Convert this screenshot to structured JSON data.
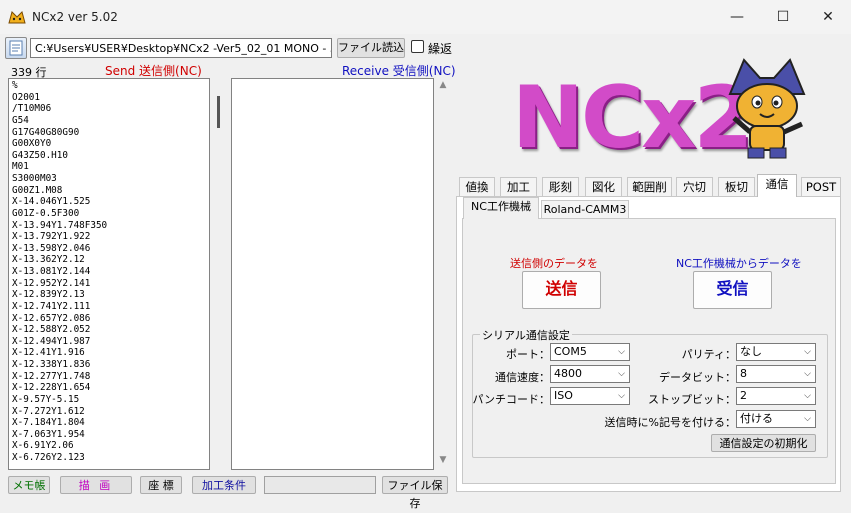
{
  "window": {
    "title": "NCx2 ver 5.02",
    "minimize": "—",
    "maximize": "☐",
    "close": "✕"
  },
  "toolbar": {
    "file_path": "C:¥Users¥USER¥Desktop¥NCx2 -Ver5_02_01 MONO - 5¥",
    "load_button": "ファイル読込",
    "repeat_label": "繰返"
  },
  "line_count": "339 行",
  "send_label": "Send 送信側(NC)",
  "recv_label": "Receive 受信側(NC)",
  "send_lines": [
    "%",
    "O2001",
    "/T10M06",
    "G54",
    "G17G40G80G90",
    "G00X0Y0",
    "G43Z50.H10",
    "M01",
    "S3000M03",
    "G00Z1.M08",
    "X-14.046Y1.525",
    "G01Z-0.5F300",
    "X-13.94Y1.748F350",
    "X-13.792Y1.922",
    "X-13.598Y2.046",
    "X-13.362Y2.12",
    "X-13.081Y2.144",
    "X-12.952Y2.141",
    "X-12.839Y2.13",
    "X-12.741Y2.111",
    "X-12.657Y2.086",
    "X-12.588Y2.052",
    "X-12.494Y1.987",
    "X-12.41Y1.916",
    "X-12.338Y1.836",
    "X-12.277Y1.748",
    "X-12.228Y1.654",
    "X-9.57Y-5.15",
    "X-7.272Y1.612",
    "X-7.184Y1.804",
    "X-7.063Y1.954",
    "X-6.91Y2.06",
    "X-6.726Y2.123"
  ],
  "bottom_buttons": {
    "memo": "メモ帳",
    "draw": "描 画",
    "coord": "座 標",
    "cond": "加工条件",
    "save": "ファイル保存"
  },
  "logo_text": "NCx2",
  "tabs": [
    "値換",
    "加工",
    "彫刻",
    "図化",
    "範囲削",
    "穴切",
    "板切",
    "通信",
    "POST"
  ],
  "subtabs": [
    "NC工作機械",
    "Roland-CAMM3"
  ],
  "comm": {
    "send_caption": "送信側のデータを",
    "recv_caption": "NC工作機械からデータを",
    "send_button": "送信",
    "recv_button": "受信"
  },
  "serial": {
    "title": "シリアル通信設定",
    "port_label": "ポート：",
    "port_value": "COM5",
    "speed_label": "通信速度：",
    "speed_value": "4800",
    "punch_label": "パンチコード：",
    "punch_value": "ISO",
    "parity_label": "パリティ：",
    "parity_value": "なし",
    "databit_label": "データビット：",
    "databit_value": "8",
    "stopbit_label": "ストップビット：",
    "stopbit_value": "2",
    "percent_label": "送信時に%記号を付ける：",
    "percent_value": "付ける",
    "reset_button": "通信設定の初期化"
  },
  "colors": {
    "send_red": "#d00000",
    "recv_blue": "#1010c0",
    "logo_pink": "#d24bc8"
  }
}
